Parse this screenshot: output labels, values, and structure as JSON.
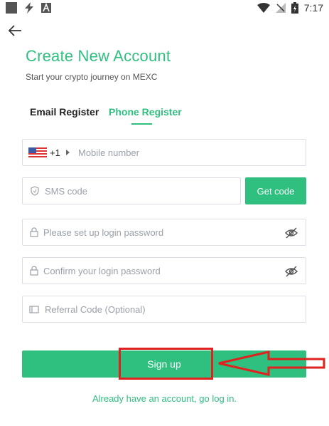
{
  "status_bar": {
    "time": "7:17",
    "left_icons": [
      "square-icon",
      "bolt-icon",
      "a-badge-icon"
    ],
    "right_icons": [
      "wifi-icon",
      "no-signal-icon",
      "battery-icon"
    ]
  },
  "header": {
    "title": "Create New Account",
    "subtitle": "Start your crypto journey on MEXC"
  },
  "tabs": [
    {
      "label": "Email Register",
      "active": false
    },
    {
      "label": "Phone Register",
      "active": true
    }
  ],
  "form": {
    "country_code": "+1",
    "mobile_placeholder": "Mobile number",
    "sms_placeholder": "SMS code",
    "get_code_label": "Get code",
    "password_placeholder": "Please set up login password",
    "confirm_placeholder": "Confirm your login password",
    "referral_placeholder": "Referral Code (Optional)",
    "signup_label": "Sign up",
    "login_link": "Already have an account, go log in."
  },
  "colors": {
    "accent": "#2fbf7f",
    "highlight": "#e0211d"
  }
}
